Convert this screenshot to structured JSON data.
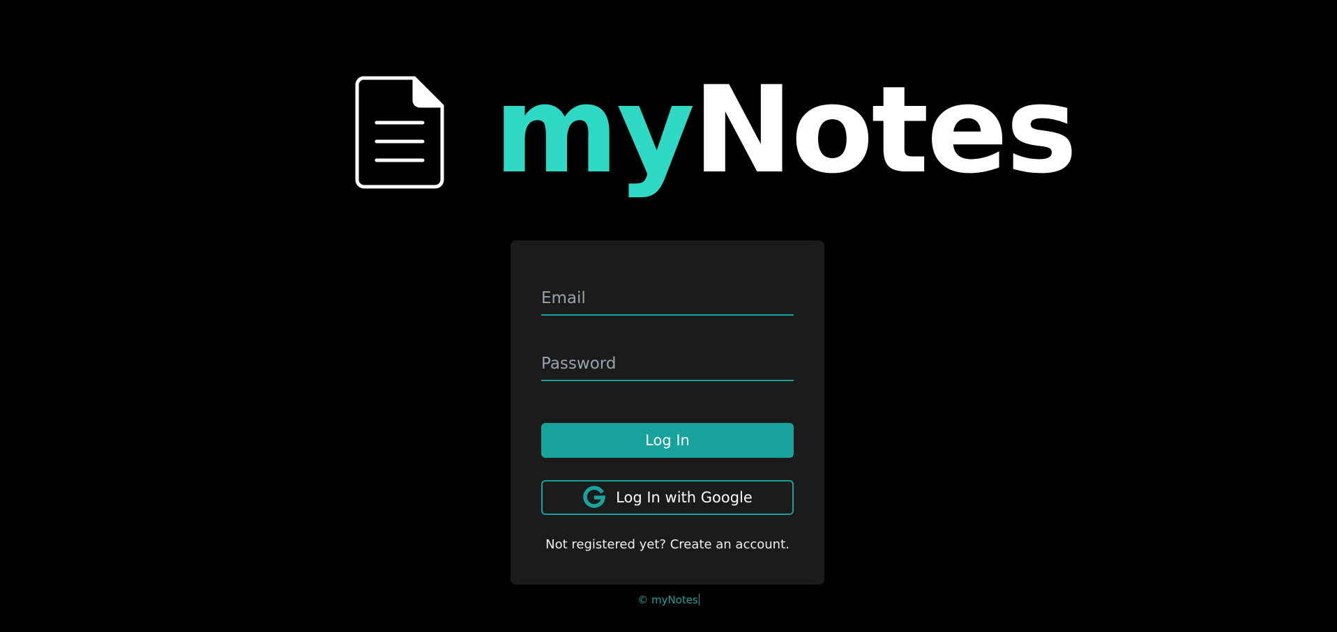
{
  "brand": {
    "name_part1": "my",
    "name_part2": "Notes",
    "icon": "document-icon",
    "accent_color": "#2fd9c5",
    "button_color": "#17a39b"
  },
  "login_form": {
    "email_placeholder": "Email",
    "email_value": "",
    "password_placeholder": "Password",
    "password_value": "",
    "login_button_label": "Log In",
    "google_button_label": "Log In with Google",
    "google_icon": "google-g-icon",
    "register_prefix": "Not registered yet?",
    "register_link": "Create an account."
  },
  "footer": {
    "copyright": "© myNotes"
  }
}
